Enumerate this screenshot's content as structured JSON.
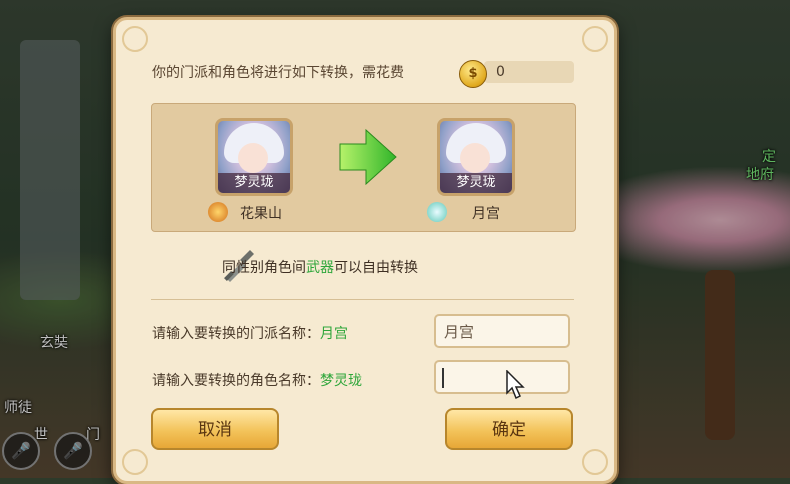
{
  "cost": {
    "text": "你的门派和角色将进行如下转换，需花费",
    "amount": "0"
  },
  "transfer": {
    "from": {
      "character": "梦灵珑",
      "sect": "花果山"
    },
    "to": {
      "character": "梦灵珑",
      "sect": "月宫"
    }
  },
  "note": {
    "before": "同性别角色间",
    "highlight": "武器",
    "after": "可以自由转换"
  },
  "fields": {
    "sect_label": "请输入要转换的门派名称：",
    "sect_hint": "月宫",
    "sect_value": "月宫",
    "role_label": "请输入要转换的角色名称：",
    "role_hint": "梦灵珑",
    "role_value": ""
  },
  "buttons": {
    "cancel": "取消",
    "confirm": "确定"
  },
  "background": {
    "left_name": "玄奘",
    "left_tabs": [
      "师徒",
      "世",
      "门"
    ],
    "right_labels": [
      "定",
      "地府"
    ]
  },
  "colors": {
    "highlight": "#2ea63a",
    "panel": "#f6ead1",
    "button": "#f3c35a"
  }
}
